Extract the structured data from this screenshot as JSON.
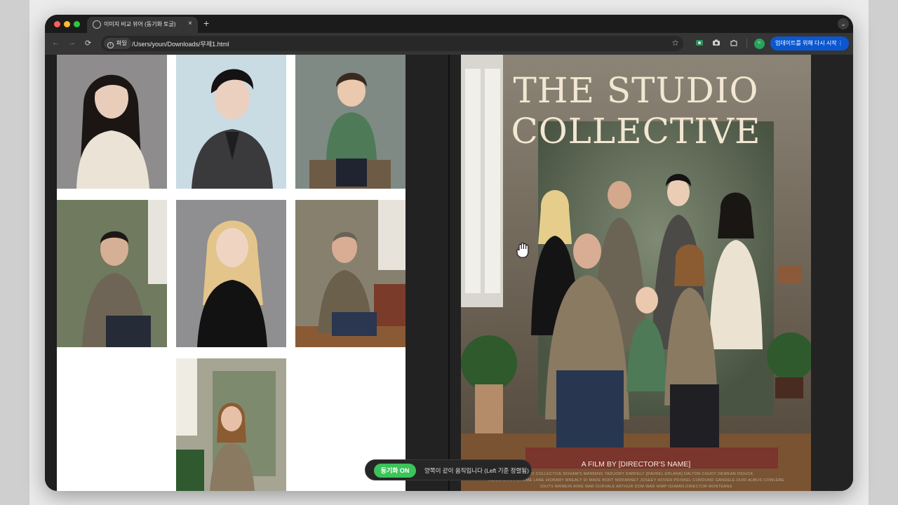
{
  "browser": {
    "tab_title": "이미지 비교 뷰어 (동기화 토글)",
    "tab_close": "×",
    "new_tab": "+",
    "site_label": "파일",
    "url": "/Users/youn/Downloads/무제1.html",
    "profile_initial": "ㄷ",
    "update_button": "업데이트를 위해 다시 시작",
    "update_menu": "⋮",
    "window_menu": "⌄",
    "nav_back": "←",
    "nav_forward": "→",
    "nav_reload": "⟳",
    "bookmark_star": "☆"
  },
  "poster": {
    "title_line1": "THE STUDIO",
    "title_line2": "COLLECTIVE",
    "credit": "A FILM BY [DIRECTOR'S NAME]",
    "billing_line1": "STUDIO COLLECTIVE  ROHAM'S MANNING  TADUORY DARFELY  [DAVREL ERLANA]  DALTON CHUDY  DEWEAN DIDUCK",
    "billing_line2": "VIBIUS DARATUHOME LANE  HIDBARY MREALY  DI MADE BORT NIDFANNET  JOSEEY HOVER PRISKEL  CORDOND GANDELE  DUIR AUBUS COWLEBE",
    "billing_line3": "JOUTS WRMEIN AIWE MAR DURVALE  ARTHUR DOM WAR  HIMP ISHMAN  DIRECTOR MONTEANS"
  },
  "sync": {
    "toggle_label": "동기화 ON",
    "status_text": "양쪽이 같이 움직입니다 (Left 기준 정렬됨)"
  },
  "colors": {
    "accent_green": "#3cc35a",
    "update_blue": "#0b57d0",
    "poster_title": "#f2e7d2"
  }
}
